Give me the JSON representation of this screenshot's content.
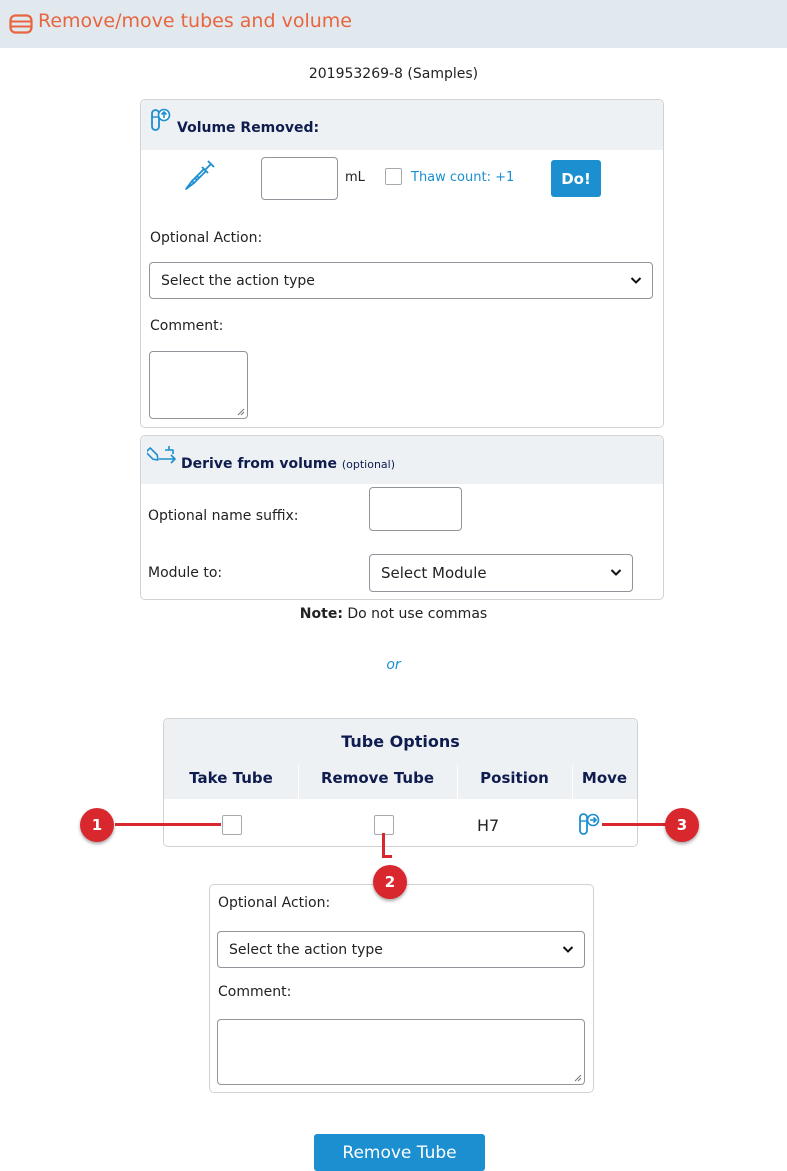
{
  "header": {
    "title": "Remove/move tubes and volume",
    "icon": "database-icon"
  },
  "sample_label": "201953269-8 (Samples)",
  "volume_panel": {
    "title": "Volume Removed:",
    "volume_unit": "mL",
    "thaw_label": "Thaw count: +1",
    "do_label": "Do!",
    "optional_action_label": "Optional Action:",
    "action_select_value": "Select the action type",
    "comment_label": "Comment:"
  },
  "derive_panel": {
    "title": "Derive from volume",
    "title_suffix": "(optional)",
    "name_suffix_label": "Optional name suffix:",
    "module_label": "Module to:",
    "module_select_value": "Select Module"
  },
  "note": {
    "bold": "Note:",
    "text": "Do not use commas"
  },
  "or_label": "or",
  "tube_options": {
    "title": "Tube Options",
    "columns": [
      "Take Tube",
      "Remove Tube",
      "Position",
      "Move"
    ],
    "row": {
      "position": "H7"
    }
  },
  "tube_action_panel": {
    "optional_action_label": "Optional Action:",
    "action_select_value": "Select the action type",
    "comment_label": "Comment:"
  },
  "remove_button_label": "Remove Tube",
  "callouts": [
    "1",
    "2",
    "3"
  ],
  "colors": {
    "accent_orange": "#e8653e",
    "primary_blue": "#1c8fd0",
    "callout_red": "#d9272e",
    "header_bg": "#e1e8ee"
  }
}
